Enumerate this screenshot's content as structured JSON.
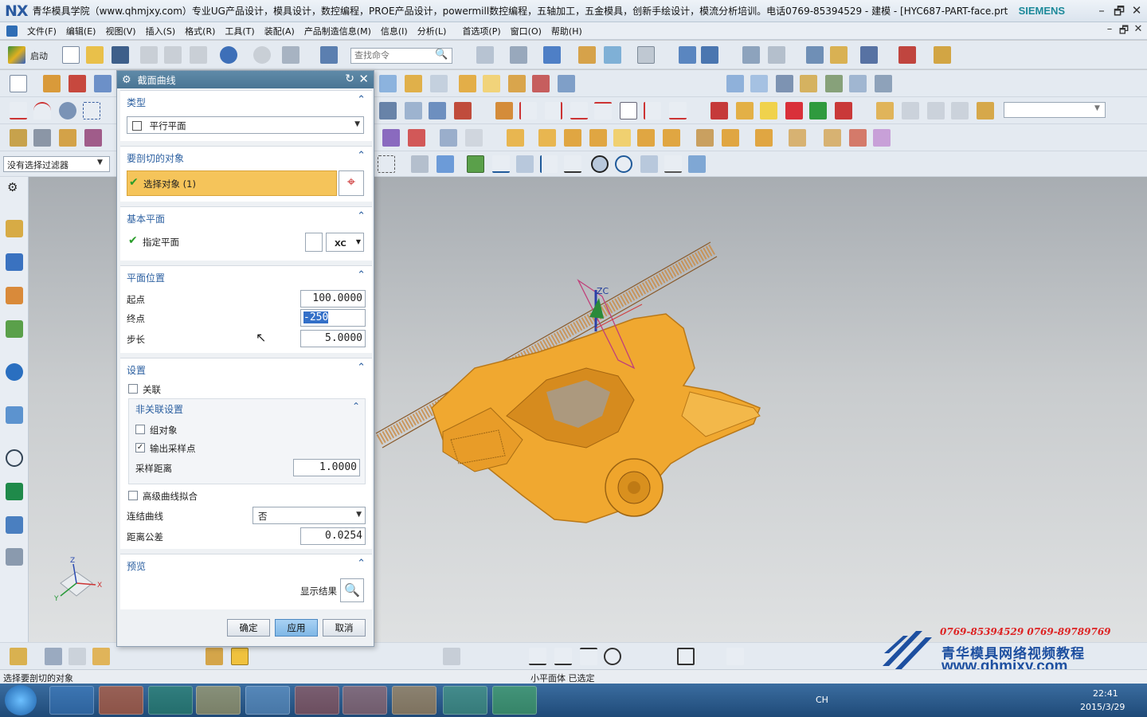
{
  "window": {
    "logo": "NX",
    "title": "青华模具学院（www.qhmjxy.com）专业UG产品设计，模具设计，数控编程，PROE产品设计，powermill数控编程，五轴加工，五金模具，创新手绘设计，模流分析培训。电话0769-85394529 - 建模 - [HYC687-PART-face.prt（...",
    "brand": "SIEMENS",
    "minimize": "–",
    "maximize": "🗗",
    "close": "✕"
  },
  "menu": {
    "items": [
      "文件(F)",
      "编辑(E)",
      "视图(V)",
      "插入(S)",
      "格式(R)",
      "工具(T)",
      "装配(A)",
      "产品制造信息(M)",
      "信息(I)",
      "分析(L)",
      "首选项(P)",
      "窗口(O)",
      "帮助(H)"
    ]
  },
  "toolbar": {
    "start_label": "启动",
    "search_placeholder": "查找命令",
    "filter_label": "没有选择过滤器"
  },
  "dialog": {
    "title": "截面曲线",
    "type_section": "类型",
    "type_value": "平行平面",
    "objects_section": "要剖切的对象",
    "select_objects": "选择对象 (1)",
    "base_plane_section": "基本平面",
    "specify_plane": "指定平面",
    "plane_xc": "XC",
    "plane_pos_section": "平面位置",
    "start_label": "起点",
    "start_value": "100.0000",
    "end_label": "终点",
    "end_value": "-250",
    "step_label": "步长",
    "step_value": "5.0000",
    "settings_section": "设置",
    "associative": "关联",
    "non_assoc_section": "非关联设置",
    "group_objects": "组对象",
    "output_sample_points": "输出采样点",
    "sample_distance_label": "采样距离",
    "sample_distance_value": "1.0000",
    "advanced_fit": "高级曲线拟合",
    "join_curves_label": "连结曲线",
    "join_curves_value": "否",
    "distance_tol_label": "距离公差",
    "distance_tol_value": "0.0254",
    "preview_section": "预览",
    "show_result": "显示结果",
    "ok": "确定",
    "apply": "应用",
    "cancel": "取消"
  },
  "status": {
    "left": "选择要剖切的对象",
    "middle": "小平面体 已选定"
  },
  "viewport": {
    "axis_label": "ZC",
    "triad_x": "X",
    "triad_y": "Y",
    "triad_z": "Z"
  },
  "taskbar": {
    "ime": "CH",
    "time": "22:41",
    "date": "2015/3/29"
  },
  "watermark": {
    "phones": "0769-85394529  0769-89789769",
    "title": "青华模具网络视频教程",
    "url": "www.qhmjxy.com"
  },
  "colors": {
    "part": "#f0a830",
    "dialog_header": "#4f7b99",
    "selection_row": "#f5c45a",
    "accent": "#2b5fa0"
  }
}
